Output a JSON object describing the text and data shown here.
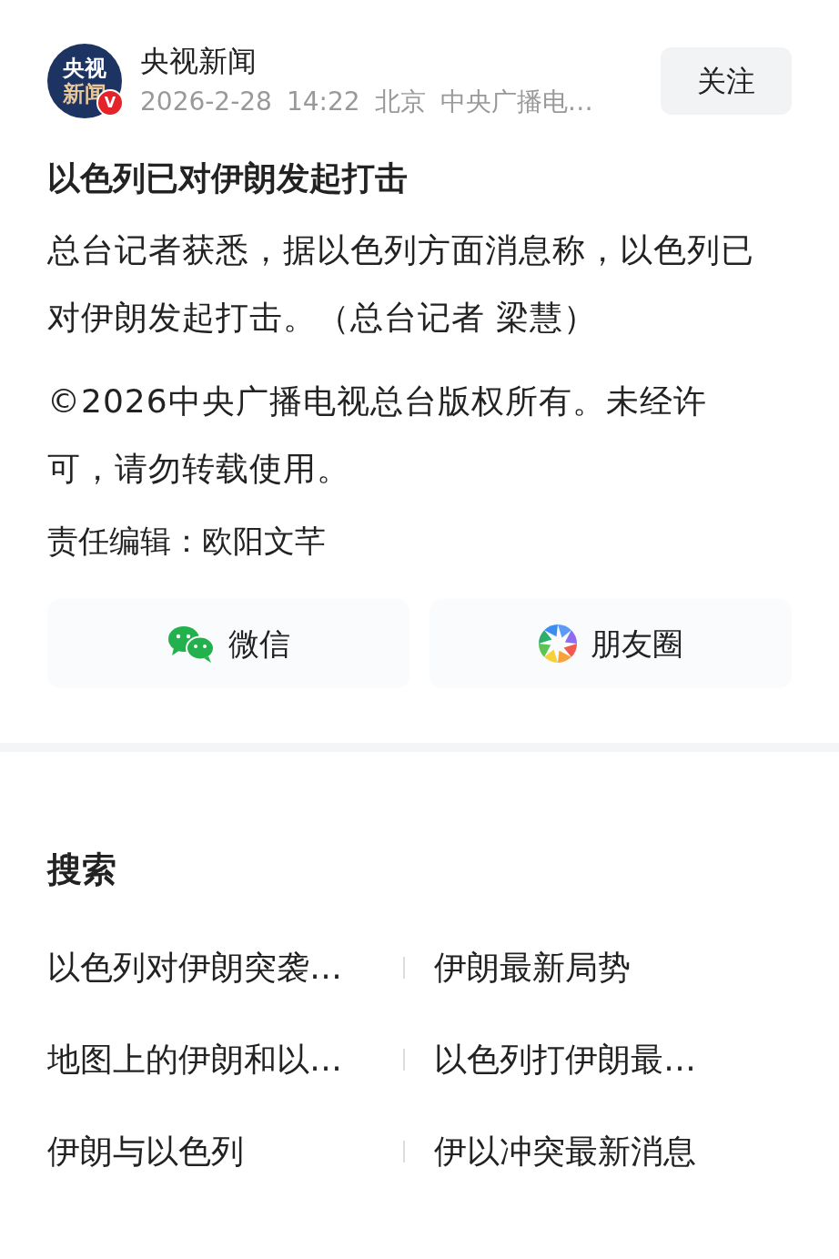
{
  "author": {
    "logo_lines": [
      "央视",
      "新闻"
    ],
    "verified_badge": "V",
    "name": "央视新闻",
    "date": "2026-2-28",
    "time": "14:22",
    "location": "北京",
    "source": "中央广播电…",
    "follow_button": "关注"
  },
  "article": {
    "title": "以色列已对伊朗发起打击",
    "paragraphs": [
      "总台记者获悉，据以色列方面消息称，以色列已对伊朗发起打击。（总台记者 梁慧）",
      "©2026中央广播电视总台版权所有。未经许可，请勿转载使用。"
    ],
    "editor": "责任编辑：欧阳文芊"
  },
  "share_buttons": [
    {
      "kind": "wechat",
      "label": "微信"
    },
    {
      "kind": "moments",
      "label": "朋友圈"
    }
  ],
  "search": {
    "title": "搜索",
    "items": [
      "以色列对伊朗突袭…",
      "伊朗最新局势",
      "地图上的伊朗和以…",
      "以色列打伊朗最…",
      "伊朗与以色列",
      "伊以冲突最新消息"
    ]
  }
}
